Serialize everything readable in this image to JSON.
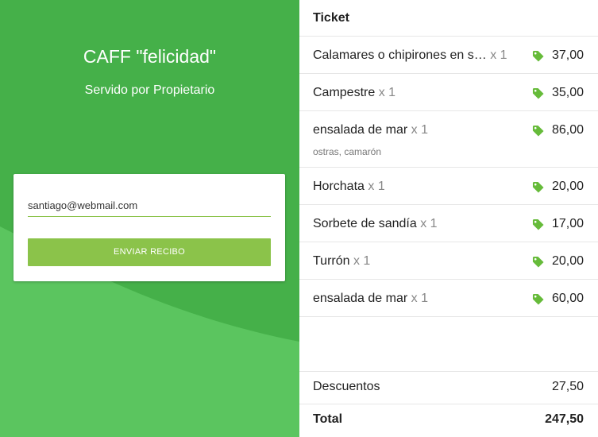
{
  "store": {
    "title": "CAFF \"felicidad\"",
    "subtitle": "Servido por Propietario"
  },
  "receipt_form": {
    "email_value": "santiago@webmail.com",
    "send_label": "ENVIAR RECIBO"
  },
  "ticket": {
    "title": "Ticket",
    "items": [
      {
        "name": "Calamares o chipirones en s…",
        "qty": "x 1",
        "price": "37,00",
        "note": ""
      },
      {
        "name": "Campestre",
        "qty": "x 1",
        "price": "35,00",
        "note": ""
      },
      {
        "name": "ensalada de mar",
        "qty": "x 1",
        "price": "86,00",
        "note": "ostras, camarón"
      },
      {
        "name": "Horchata",
        "qty": "x 1",
        "price": "20,00",
        "note": ""
      },
      {
        "name": "Sorbete de sandía",
        "qty": "x 1",
        "price": "17,00",
        "note": ""
      },
      {
        "name": "Turrón",
        "qty": "x 1",
        "price": "20,00",
        "note": ""
      },
      {
        "name": "ensalada de mar",
        "qty": "x 1",
        "price": "60,00",
        "note": ""
      }
    ],
    "discounts_label": "Descuentos",
    "discounts_value": "27,50",
    "total_label": "Total",
    "total_value": "247,50"
  },
  "colors": {
    "primary_green": "#45b049",
    "accent_green": "#8bc34a",
    "tag_green": "#66bb3a"
  },
  "icons": {
    "price_tag": "tag-icon"
  }
}
